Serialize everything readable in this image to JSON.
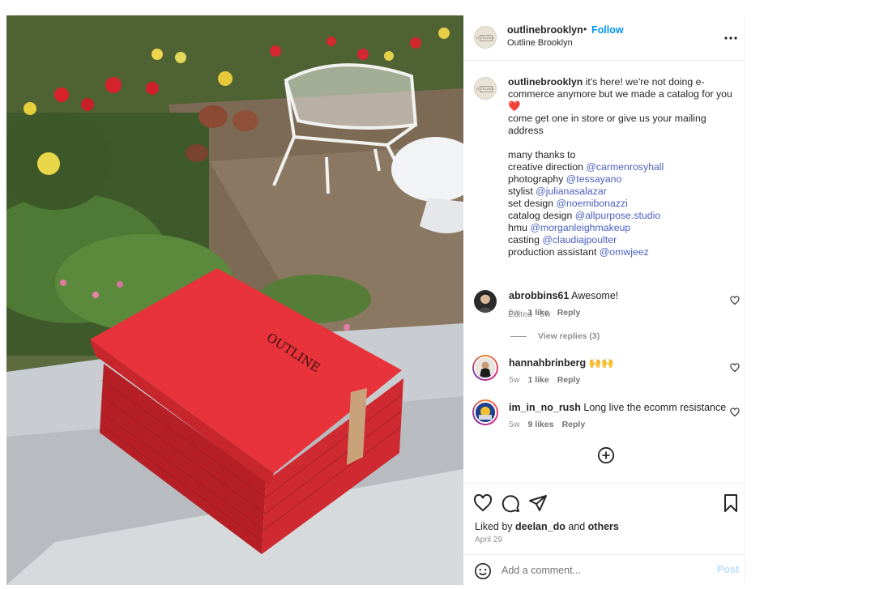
{
  "post": {
    "username": "outlinebrooklyn",
    "separator": "•",
    "follow_label": "Follow",
    "location": "Outline Brooklyn",
    "avatar_text": "OUTLINE",
    "catalog_cover_text": "OUTLINE"
  },
  "caption": {
    "username": "outlinebrooklyn",
    "line1": " it's here! we're not doing e-commerce anymore but we made a catalog for you ",
    "heart_emoji": "❤️",
    "line2": "come get one in store or give us your mailing address",
    "thanks": "many thanks to",
    "credits": [
      {
        "role": "creative direction ",
        "handle": "@carmenrosyhall"
      },
      {
        "role": "photography ",
        "handle": "@tessayano"
      },
      {
        "role": "stylist ",
        "handle": "@julianasalazar"
      },
      {
        "role": "set design ",
        "handle": "@noemibonazzi"
      },
      {
        "role": "catalog design ",
        "handle": "@allpurpose.studio"
      },
      {
        "role": "hmu ",
        "handle": "@morganleighmakeup"
      },
      {
        "role": "casting ",
        "handle": "@claudiajpoulter"
      },
      {
        "role": "production assistant ",
        "handle": "@omwjeez"
      }
    ],
    "edited": "Edited · 5w"
  },
  "comments": [
    {
      "username": "abrobbins61",
      "text": " Awesome!",
      "time": "5w",
      "likes": "1 like",
      "reply": "Reply"
    },
    {
      "username": "hannahbrinberg",
      "text": " 🙌🙌",
      "time": "5w",
      "likes": "1 like",
      "reply": "Reply"
    },
    {
      "username": "im_in_no_rush",
      "text": " Long live the ecomm resistance",
      "time": "5w",
      "likes": "9 likes",
      "reply": "Reply"
    }
  ],
  "view_replies": "View replies (3)",
  "liked_by": {
    "prefix": "Liked by ",
    "user": "deelan_do",
    "mid": " and ",
    "others": "others"
  },
  "date": "April 29",
  "add_comment": {
    "placeholder": "Add a comment...",
    "post_label": "Post"
  },
  "colors": {
    "accent": "#0095f6",
    "mention": "#4a5fc1",
    "catalog_red": "#e8333a"
  }
}
